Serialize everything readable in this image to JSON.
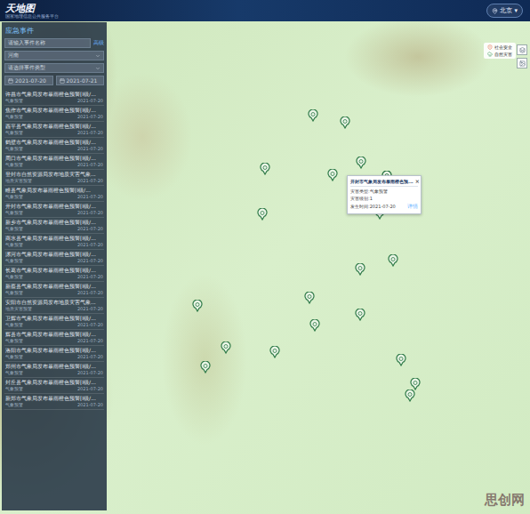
{
  "header": {
    "logo": "天地图",
    "subtitle": "国家地理信息公共服务平台",
    "city": "北京",
    "city_arrow": "▾"
  },
  "sidebar": {
    "title": "应急事件",
    "search": {
      "placeholder": "请输入事件名称",
      "button": "高级"
    },
    "region": "河南",
    "type": {
      "placeholder": "请选择事件类型"
    },
    "date_from": "2021-07-20",
    "date_to": "2021-07-21",
    "items": [
      {
        "title": "许昌市气象局发布暴雨橙色预警[I级/...",
        "kind": "气象预警",
        "date": "2021-07-20"
      },
      {
        "title": "焦作市气象局发布暴雨橙色预警[I级/...",
        "kind": "气象预警",
        "date": "2021-07-20"
      },
      {
        "title": "西平县气象局发布暴雨橙色预警[I级/...",
        "kind": "气象预警",
        "date": "2021-07-20"
      },
      {
        "title": "鹤壁市气象局发布暴雨橙色预警[I级/...",
        "kind": "气象预警",
        "date": "2021-07-20"
      },
      {
        "title": "周口市气象局发布暴雨橙色预警[I级/...",
        "kind": "气象预警",
        "date": "2021-07-20"
      },
      {
        "title": "登封市自然资源局发布地质灾害气象...",
        "kind": "地质灾害预警",
        "date": "2021-07-20"
      },
      {
        "title": "睢县气象局发布暴雨橙色预警[I级/...",
        "kind": "气象预警",
        "date": "2021-07-20"
      },
      {
        "title": "开封市气象局发布暴雨橙色预警[I级/...",
        "kind": "气象预警",
        "date": "2021-07-20"
      },
      {
        "title": "新乡市气象局发布暴雨橙色预警[I级/...",
        "kind": "气象预警",
        "date": "2021-07-20"
      },
      {
        "title": "商水县气象局发布暴雨橙色预警[I级/...",
        "kind": "气象预警",
        "date": "2021-07-20"
      },
      {
        "title": "漯河市气象局发布暴雨橙色预警[I级/...",
        "kind": "气象预警",
        "date": "2021-07-20"
      },
      {
        "title": "长葛市气象局发布暴雨橙色预警[I级/...",
        "kind": "气象预警",
        "date": "2021-07-20"
      },
      {
        "title": "新蔡县气象局发布暴雨橙色预警[I级/...",
        "kind": "气象预警",
        "date": "2021-07-20"
      },
      {
        "title": "安阳市自然资源局发布地质灾害气象...",
        "kind": "地质灾害预警",
        "date": "2021-07-20"
      },
      {
        "title": "卫辉市气象局发布暴雨橙色预警[I级/...",
        "kind": "气象预警",
        "date": "2021-07-20"
      },
      {
        "title": "辉县市气象局发布暴雨橙色预警[I级/...",
        "kind": "气象预警",
        "date": "2021-07-20"
      },
      {
        "title": "洛阳市气象局发布暴雨橙色预警[I级/...",
        "kind": "气象预警",
        "date": "2021-07-20"
      },
      {
        "title": "郑州市气象局发布暴雨橙色预警[I级/...",
        "kind": "气象预警",
        "date": "2021-07-20"
      },
      {
        "title": "封丘县气象局发布暴雨橙色预警[I级/...",
        "kind": "气象预警",
        "date": "2021-07-20"
      },
      {
        "title": "新郑市气象局发布暴雨橙色预警[I级/...",
        "kind": "气象预警",
        "date": "2021-07-20"
      }
    ]
  },
  "legend": [
    {
      "label": "社会安全",
      "color": "#e0603c"
    },
    {
      "label": "自然灾害",
      "color": "#3f9a5c"
    }
  ],
  "popup": {
    "title": "开封市气象局发布暴雨橙色预...",
    "close": "×",
    "lines": [
      "灾害类型:气象预警",
      "灾害级别:1",
      "发生时间:2021-07-20"
    ],
    "link": "详情"
  },
  "pins": [
    {
      "selected": false
    },
    {
      "selected": false
    },
    {
      "selected": false
    },
    {
      "selected": false
    },
    {
      "selected": true
    },
    {
      "selected": false
    },
    {
      "selected": false
    },
    {
      "selected": false
    },
    {
      "selected": false
    },
    {
      "selected": false
    },
    {
      "selected": false
    },
    {
      "selected": false
    },
    {
      "selected": false
    },
    {
      "selected": false
    },
    {
      "selected": false
    },
    {
      "selected": false
    },
    {
      "selected": false
    },
    {
      "selected": false
    },
    {
      "selected": false
    },
    {
      "selected": false
    }
  ],
  "watermark": "思创网"
}
